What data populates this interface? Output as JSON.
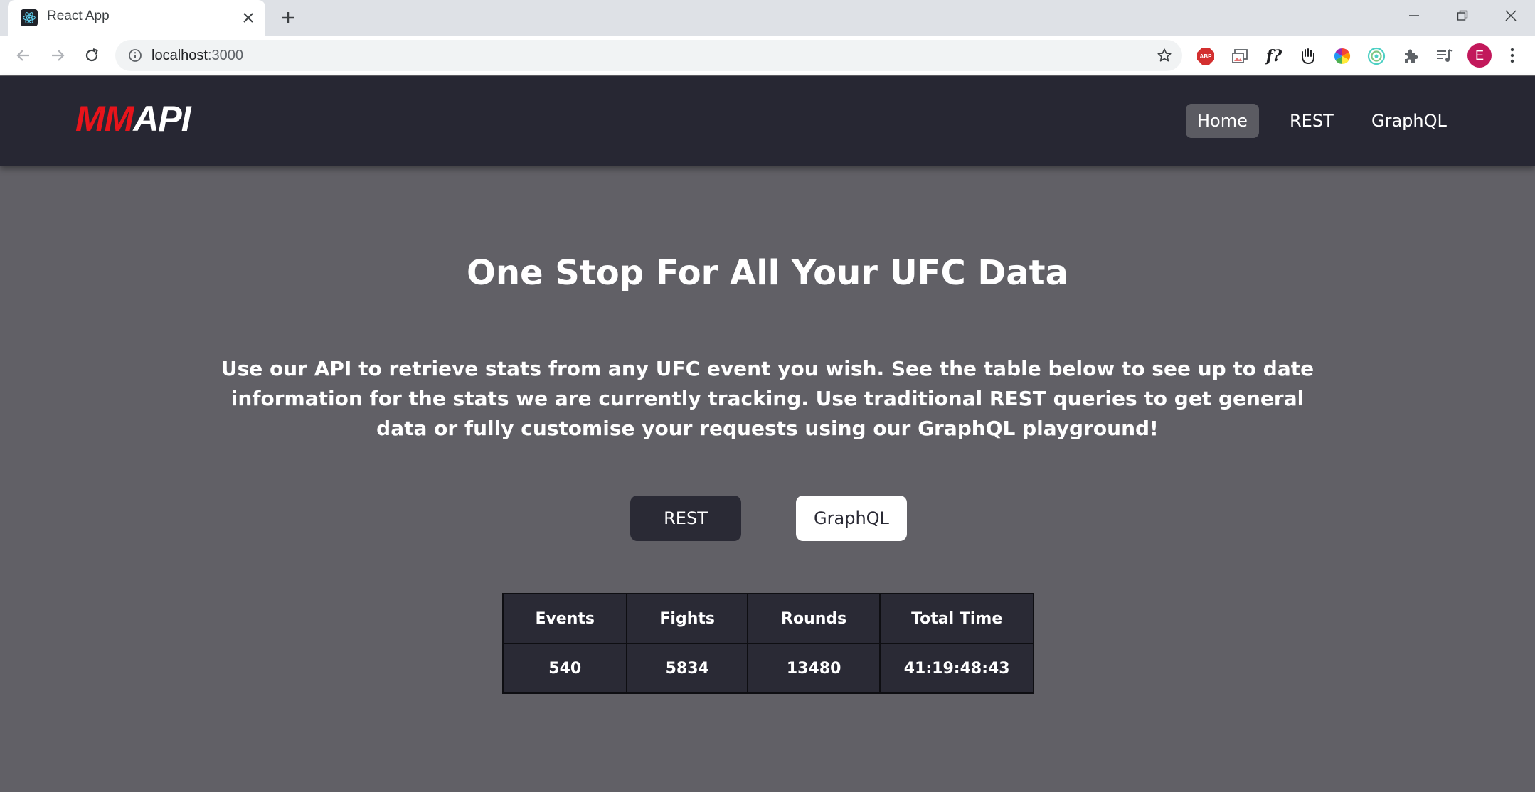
{
  "browser": {
    "tab_title": "React App",
    "url_host": "localhost",
    "url_port": ":3000",
    "extensions": [
      {
        "name": "adblock-icon"
      },
      {
        "name": "image-ext-icon"
      },
      {
        "name": "font-ext-icon",
        "text": "f?"
      },
      {
        "name": "hand-ext-icon"
      },
      {
        "name": "color-wheel-ext-icon"
      },
      {
        "name": "target-ext-icon"
      },
      {
        "name": "puzzle-icon"
      },
      {
        "name": "media-playlist-icon"
      }
    ],
    "profile_initial": "E",
    "colors": {
      "tabstrip": "#dee1e6",
      "omnibox": "#f1f3f4",
      "profile": "#c2185b"
    }
  },
  "app": {
    "logo": {
      "part1": "MM",
      "part2": "API"
    },
    "nav": {
      "home": "Home",
      "rest": "REST",
      "graphql": "GraphQL"
    },
    "colors": {
      "navbar": "#272733",
      "background": "#616066",
      "logo_red": "#e8141b",
      "active_nav": "#5b5b62"
    }
  },
  "hero": {
    "title": "One Stop For All Your UFC Data",
    "description": "Use our API to retrieve stats from any UFC event you wish. See the table below to see up to date information for the stats we are currently tracking. Use traditional REST queries to get general data or fully customise your requests using our GraphQL playground!",
    "buttons": {
      "rest": "REST",
      "graphql": "GraphQL"
    }
  },
  "stats": {
    "headers": [
      "Events",
      "Fights",
      "Rounds",
      "Total Time"
    ],
    "values": [
      "540",
      "5834",
      "13480",
      "41:19:48:43"
    ]
  }
}
